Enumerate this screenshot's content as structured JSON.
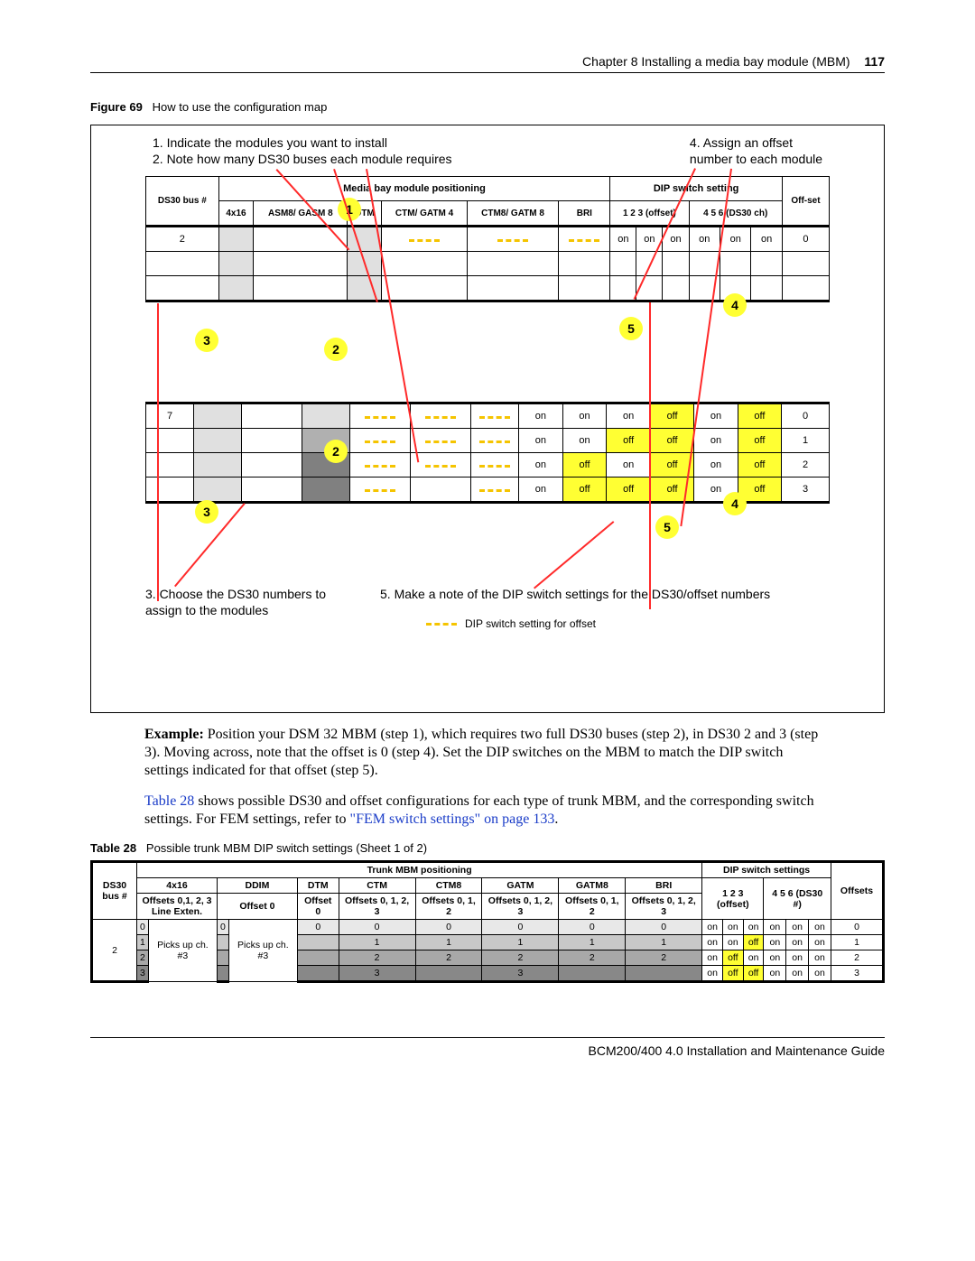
{
  "page": {
    "chapter": "Chapter 8  Installing a media bay module (MBM)",
    "number": "117",
    "footer": "BCM200/400 4.0 Installation and Maintenance Guide"
  },
  "figure69": {
    "label": "Figure 69",
    "caption": "How to use the configuration map",
    "step1": "1. Indicate the modules you want to install",
    "step2": "2. Note how many DS30 buses each module requires",
    "step4a": "4. Assign an offset",
    "step4b": "number to each module",
    "step3a": "3. Choose the DS30 numbers to",
    "step3b": "assign to the modules",
    "step5": "5. Make a note of the DIP switch settings for the DS30/offset numbers",
    "legend": "DIP switch setting for offset",
    "header": {
      "mbm_pos": "Media bay module positioning",
      "dip": "DIP switch setting",
      "ds30": "DS30 bus #",
      "x416": "4x16",
      "asm8": "ASM8/ GASM 8",
      "dtm": "DTM",
      "ctm4": "CTM/ GATM 4",
      "ctm8": "CTM8/ GATM 8",
      "bri": "BRI",
      "sw123": "1    2    3 (offset)",
      "sw456": "4    5    6 (DS30 ch)",
      "offset": "Off-set"
    },
    "rows": [
      {
        "bus": "2",
        "sw": [
          "on",
          "on",
          "on",
          "on",
          "on",
          "on"
        ],
        "offset": "0"
      },
      {
        "bus": "7",
        "sw": [
          "on",
          "on",
          "on",
          "off",
          "on",
          "off"
        ],
        "offset": "0"
      },
      {
        "bus": "",
        "sw": [
          "on",
          "on",
          "off",
          "off",
          "on",
          "off"
        ],
        "offset": "1"
      },
      {
        "bus": "",
        "sw": [
          "on",
          "off",
          "on",
          "off",
          "on",
          "off"
        ],
        "offset": "2"
      },
      {
        "bus": "",
        "sw": [
          "on",
          "off",
          "off",
          "off",
          "on",
          "off"
        ],
        "offset": "3"
      }
    ]
  },
  "example": {
    "prefix": "Example:",
    "text": " Position your DSM 32 MBM (step 1), which requires two full DS30 buses (step 2), in DS30 2 and 3 (step 3). Moving across, note that the offset is 0 (step 4). Set the DIP switches on the MBM to match the DIP switch settings indicated for that offset (step 5).",
    "p2a": "Table 28",
    "p2b": " shows possible DS30 and offset configurations for each type of trunk MBM, and the corresponding switch settings. For FEM settings, refer to ",
    "p2c": "\"FEM switch settings\" on page 133",
    "p2d": "."
  },
  "table28": {
    "label": "Table 28",
    "caption": "Possible trunk MBM DIP switch settings (Sheet 1 of 2)",
    "h": {
      "ds30": "DS30 bus #",
      "trunk": "Trunk MBM positioning",
      "dip": "DIP switch settings",
      "offsets": "Offsets",
      "x416a": "4x16",
      "x416b": "Offsets 0,1, 2, 3",
      "x416c": "Line  Exten.",
      "ddim": "DDIM",
      "ddim_b": "Offset 0",
      "dtm": "DTM",
      "dtm_b": "Offset 0",
      "ctm": "CTM",
      "ctm_b": "Offsets 0, 1, 2, 3",
      "ctm8": "CTM8",
      "ctm8_b": "Offsets 0, 1, 2",
      "gatm": "GATM",
      "gatm_b": "Offsets 0, 1, 2, 3",
      "gatm8": "GATM8",
      "gatm8_b": "Offsets 0, 1, 2",
      "bri": "BRI",
      "bri_b": "Offsets 0, 1, 2, 3",
      "sw1": "1    2    3 (offset)",
      "sw2": "4    5    6 (DS30 #)"
    },
    "bus": "2",
    "picks": "Picks up ch. #3",
    "cell_vals": [
      "0",
      "1",
      "2",
      "3"
    ],
    "sw_rows": [
      [
        "on",
        "on",
        "on",
        "on",
        "on",
        "on"
      ],
      [
        "on",
        "on",
        "off",
        "on",
        "on",
        "on"
      ],
      [
        "on",
        "off",
        "on",
        "on",
        "on",
        "on"
      ],
      [
        "on",
        "off",
        "off",
        "on",
        "on",
        "on"
      ]
    ],
    "off_col": [
      "0",
      "1",
      "2",
      "3"
    ]
  }
}
